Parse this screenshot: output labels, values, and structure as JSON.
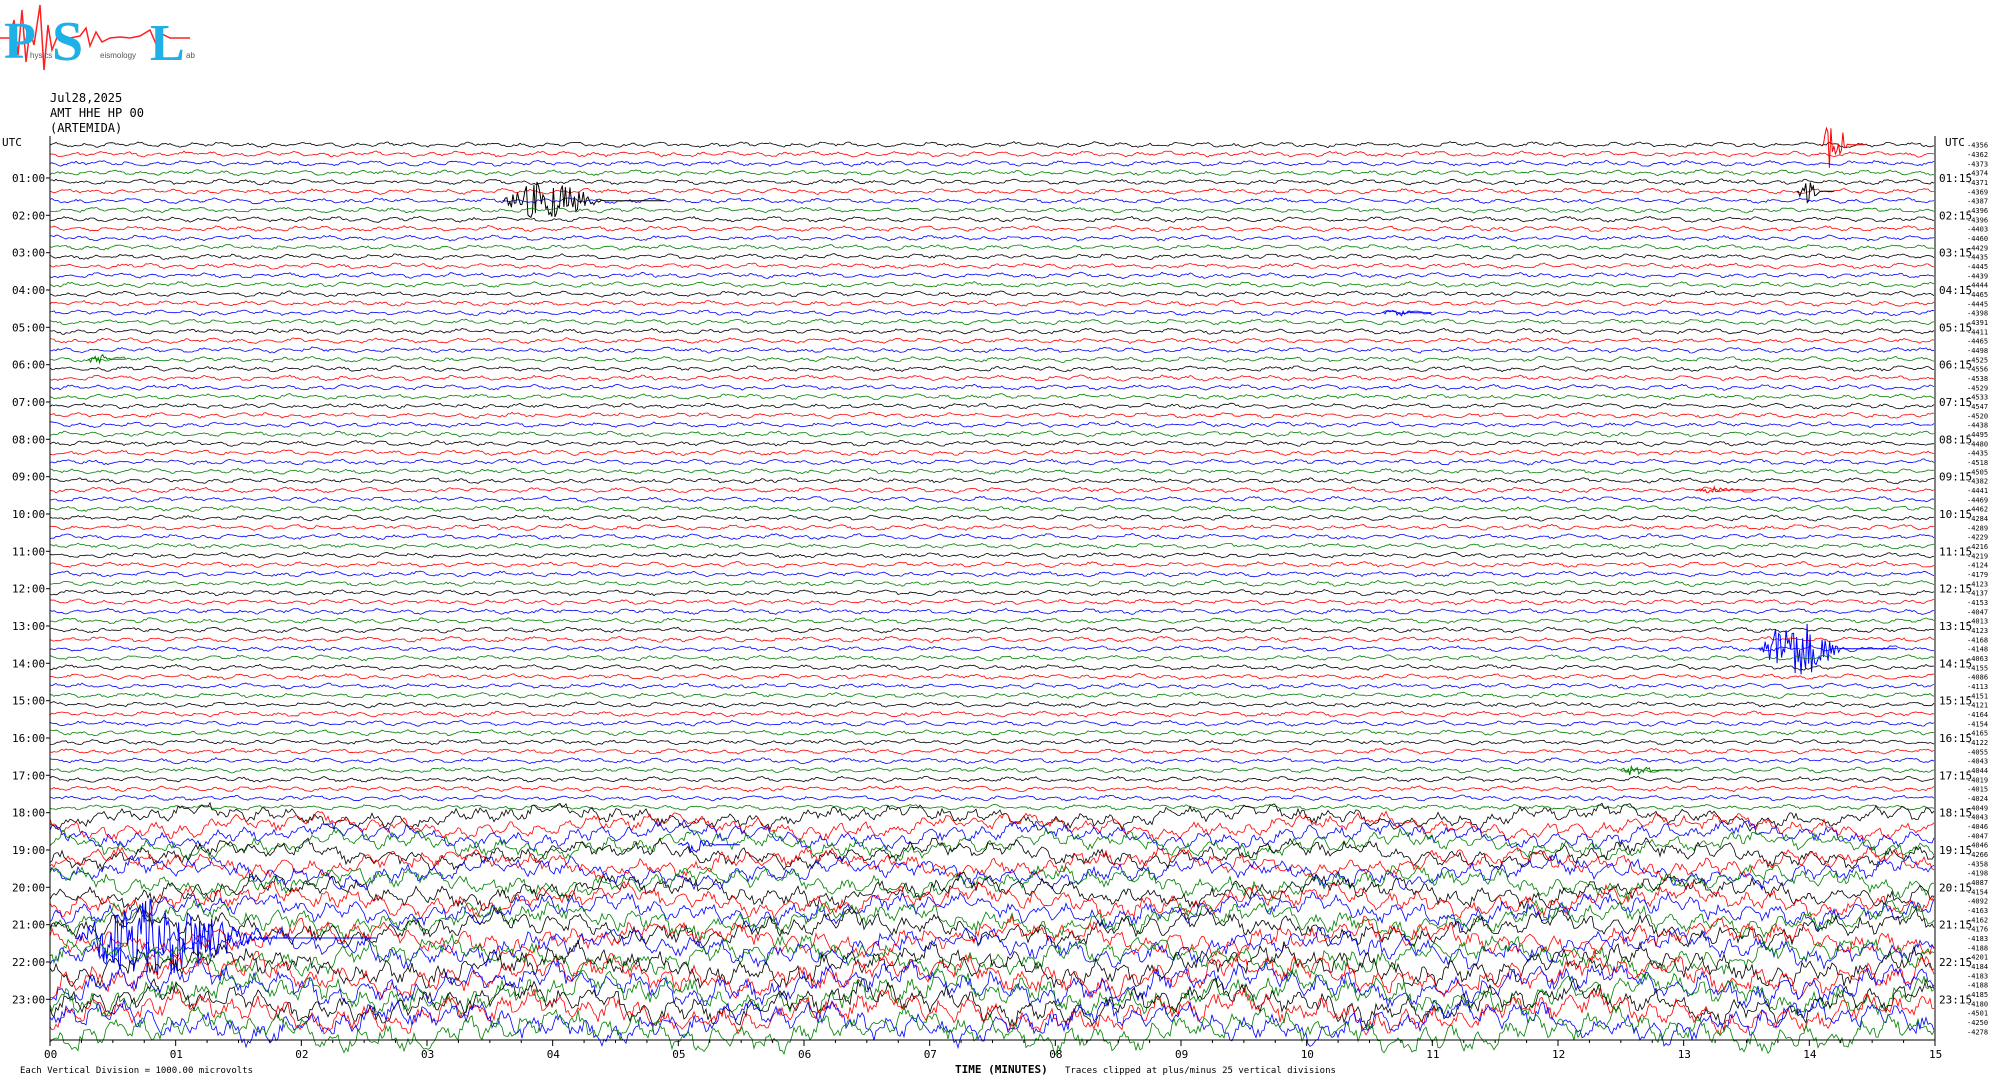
{
  "logo": {
    "letters": [
      "P",
      "S",
      "L"
    ],
    "subtext": [
      "hysics",
      "eismology",
      "ab"
    ]
  },
  "header": {
    "date": "Jul28,2025",
    "channel": "AMT HHE HP 00",
    "station": "(ARTEMIDA)"
  },
  "chart_data": {
    "type": "line",
    "title": "",
    "xlabel": "TIME (MINUTES)",
    "x_ticks": [
      "00",
      "01",
      "02",
      "03",
      "04",
      "05",
      "06",
      "07",
      "08",
      "09",
      "10",
      "11",
      "12",
      "13",
      "14",
      "15"
    ],
    "xlim": [
      0,
      15
    ],
    "left_axis_label": "UTC",
    "right_axis_label": "UTC",
    "left_ticks": [
      "01:00",
      "02:00",
      "03:00",
      "04:00",
      "05:00",
      "06:00",
      "07:00",
      "08:00",
      "09:00",
      "10:00",
      "11:00",
      "12:00",
      "13:00",
      "14:00",
      "15:00",
      "16:00",
      "17:00",
      "18:00",
      "19:00",
      "20:00",
      "21:00",
      "22:00",
      "23:00"
    ],
    "right_ticks": [
      "01:15",
      "02:15",
      "03:15",
      "04:15",
      "05:15",
      "06:15",
      "07:15",
      "08:15",
      "09:15",
      "10:15",
      "11:15",
      "12:15",
      "13:15",
      "14:15",
      "15:15",
      "16:15",
      "17:15",
      "18:15",
      "19:15",
      "20:15",
      "21:15",
      "22:15",
      "23:15"
    ],
    "trace_count": 96,
    "trace_minutes": 15,
    "trace_colors": [
      "#000000",
      "#ff0000",
      "#0000ff",
      "#008000"
    ],
    "trace_offsets": [
      -4356,
      -4362,
      -4373,
      -4374,
      -4371,
      -4369,
      -4387,
      -4396,
      -4396,
      -4403,
      -4460,
      -4429,
      -4435,
      -4445,
      -4439,
      -4444,
      -4465,
      -4445,
      -4398,
      -4391,
      -4411,
      -4465,
      -4498,
      -4525,
      -4556,
      -4538,
      -4529,
      -4533,
      -4547,
      -4520,
      -4438,
      -4495,
      -4480,
      -4435,
      -4518,
      -4505,
      -4382,
      -4441,
      -4469,
      -4462,
      -4284,
      -4289,
      -4229,
      -4216,
      -4219,
      -4124,
      -4179,
      -4123,
      -4137,
      -4153,
      -4047,
      -4013,
      -4123,
      -4168,
      -4148,
      -4063,
      -4155,
      -4086,
      -4113,
      -4151,
      -4121,
      -4164,
      -4154,
      -4165,
      -4122,
      -4055,
      -4043,
      -4044,
      -4019,
      -4015,
      -4024,
      -4049,
      -4043,
      -4046,
      -4047,
      -4046,
      -4266,
      -4358,
      -4198,
      -4087,
      -4154,
      -4092,
      -4163,
      -4162,
      -4176,
      -4183,
      -4188,
      -4201,
      -4184,
      -4183,
      -4188,
      -4185,
      -4180,
      -4501,
      -4250,
      -4278
    ],
    "events": [
      {
        "minute": 14.1,
        "trace": 0,
        "color": "#ff0000",
        "amp": 42,
        "dur": 0.35
      },
      {
        "minute": 13.9,
        "trace": 5,
        "color": "#000000",
        "amp": 18,
        "dur": 0.3
      },
      {
        "minute": 3.6,
        "trace": 6,
        "color": "#000000",
        "amp": 30,
        "dur": 1.3
      },
      {
        "minute": 10.6,
        "trace": 18,
        "color": "#0000ff",
        "amp": 6,
        "dur": 0.4
      },
      {
        "minute": 0.3,
        "trace": 23,
        "color": "#008000",
        "amp": 10,
        "dur": 0.3
      },
      {
        "minute": 13.1,
        "trace": 37,
        "color": "#ff0000",
        "amp": 5,
        "dur": 0.5
      },
      {
        "minute": 13.6,
        "trace": 54,
        "color": "#0000ff",
        "amp": 45,
        "dur": 1.1
      },
      {
        "minute": 12.5,
        "trace": 67,
        "color": "#008000",
        "amp": 10,
        "dur": 0.5
      },
      {
        "minute": 5.0,
        "trace": 75,
        "color": "#0000ff",
        "amp": 12,
        "dur": 0.5
      },
      {
        "minute": 0.2,
        "trace": 85,
        "color": "#0000ff",
        "amp": 60,
        "dur": 2.4
      }
    ]
  },
  "footer": {
    "left": "Each Vertical Division = 1000.00 microvolts",
    "right": "Traces clipped at plus/minus 25 vertical divisions"
  }
}
